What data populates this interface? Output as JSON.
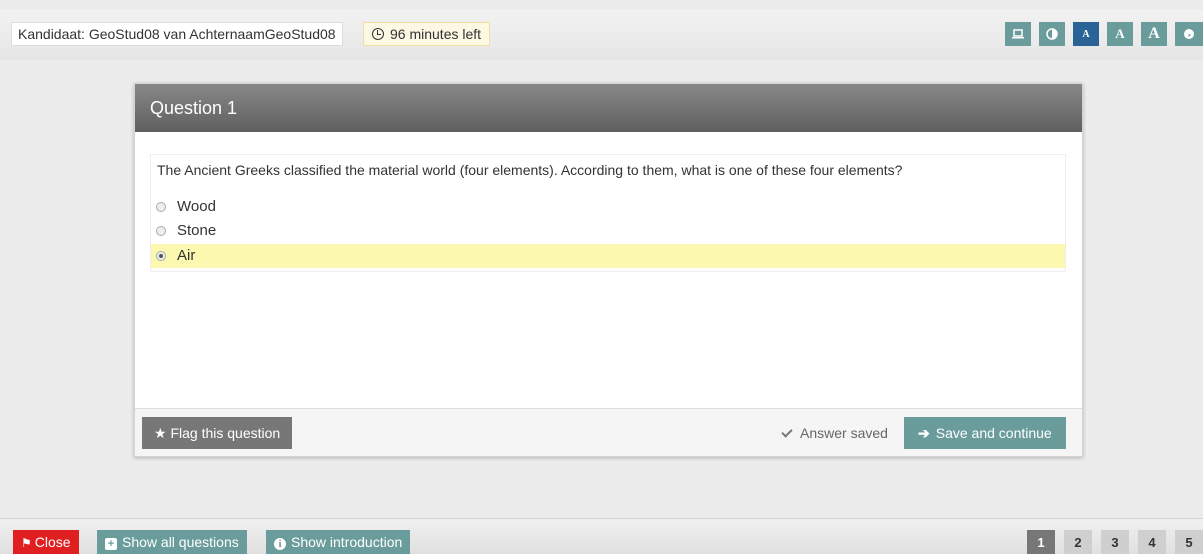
{
  "header": {
    "candidate": "Kandidaat: GeoStud08 van AchternaamGeoStud08",
    "timer": "96 minutes left",
    "tools": [
      {
        "icon": "laptop-icon",
        "glyph": "▭"
      },
      {
        "icon": "contrast-icon",
        "glyph": "◐"
      },
      {
        "icon": "font-small-icon",
        "glyph": "A"
      },
      {
        "icon": "font-medium-icon",
        "glyph": "A"
      },
      {
        "icon": "font-large-icon",
        "glyph": "A"
      },
      {
        "icon": "globe-icon",
        "glyph": "◕"
      }
    ]
  },
  "question": {
    "title": "Question 1",
    "text": "The Ancient Greeks classified the material world (four elements). According to them, what is one of these four elements?",
    "options": [
      "Wood",
      "Stone",
      "Air"
    ],
    "selected_option": "Air"
  },
  "footer": {
    "flag_label": "Flag this question",
    "answer_saved": "Answer saved",
    "save_label": "Save and continue"
  },
  "bottom": {
    "close_label": "Close",
    "show_all_label": "Show all questions",
    "show_intro_label": "Show introduction",
    "pages": [
      "1",
      "2",
      "3",
      "4",
      "5"
    ],
    "current_page": "1"
  },
  "colors": {
    "accent": "#6a9c9c",
    "active_tool": "#2a6496",
    "close": "#e02020",
    "highlight": "#fcf8b0"
  }
}
